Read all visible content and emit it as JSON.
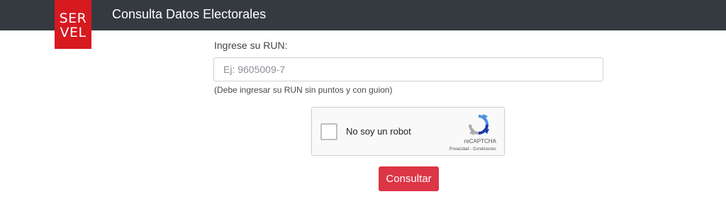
{
  "header": {
    "logo_line1": "SER",
    "logo_line2": "VEL",
    "title": "Consulta Datos Electorales"
  },
  "form": {
    "run_label": "Ingrese su RUN:",
    "run_value": "",
    "run_placeholder": "Ej: 9605009-7",
    "run_help": "(Debe ingresar su RUN sin puntos y con guion)",
    "submit_label": "Consultar"
  },
  "captcha": {
    "label": "No soy un robot",
    "checked": false,
    "brand": "reCAPTCHA",
    "links": "Privacidad - Condiciones",
    "icon": "recaptcha-icon"
  },
  "colors": {
    "topbar": "#343a40",
    "brand_red": "#d71920",
    "button_red": "#dc3545"
  }
}
